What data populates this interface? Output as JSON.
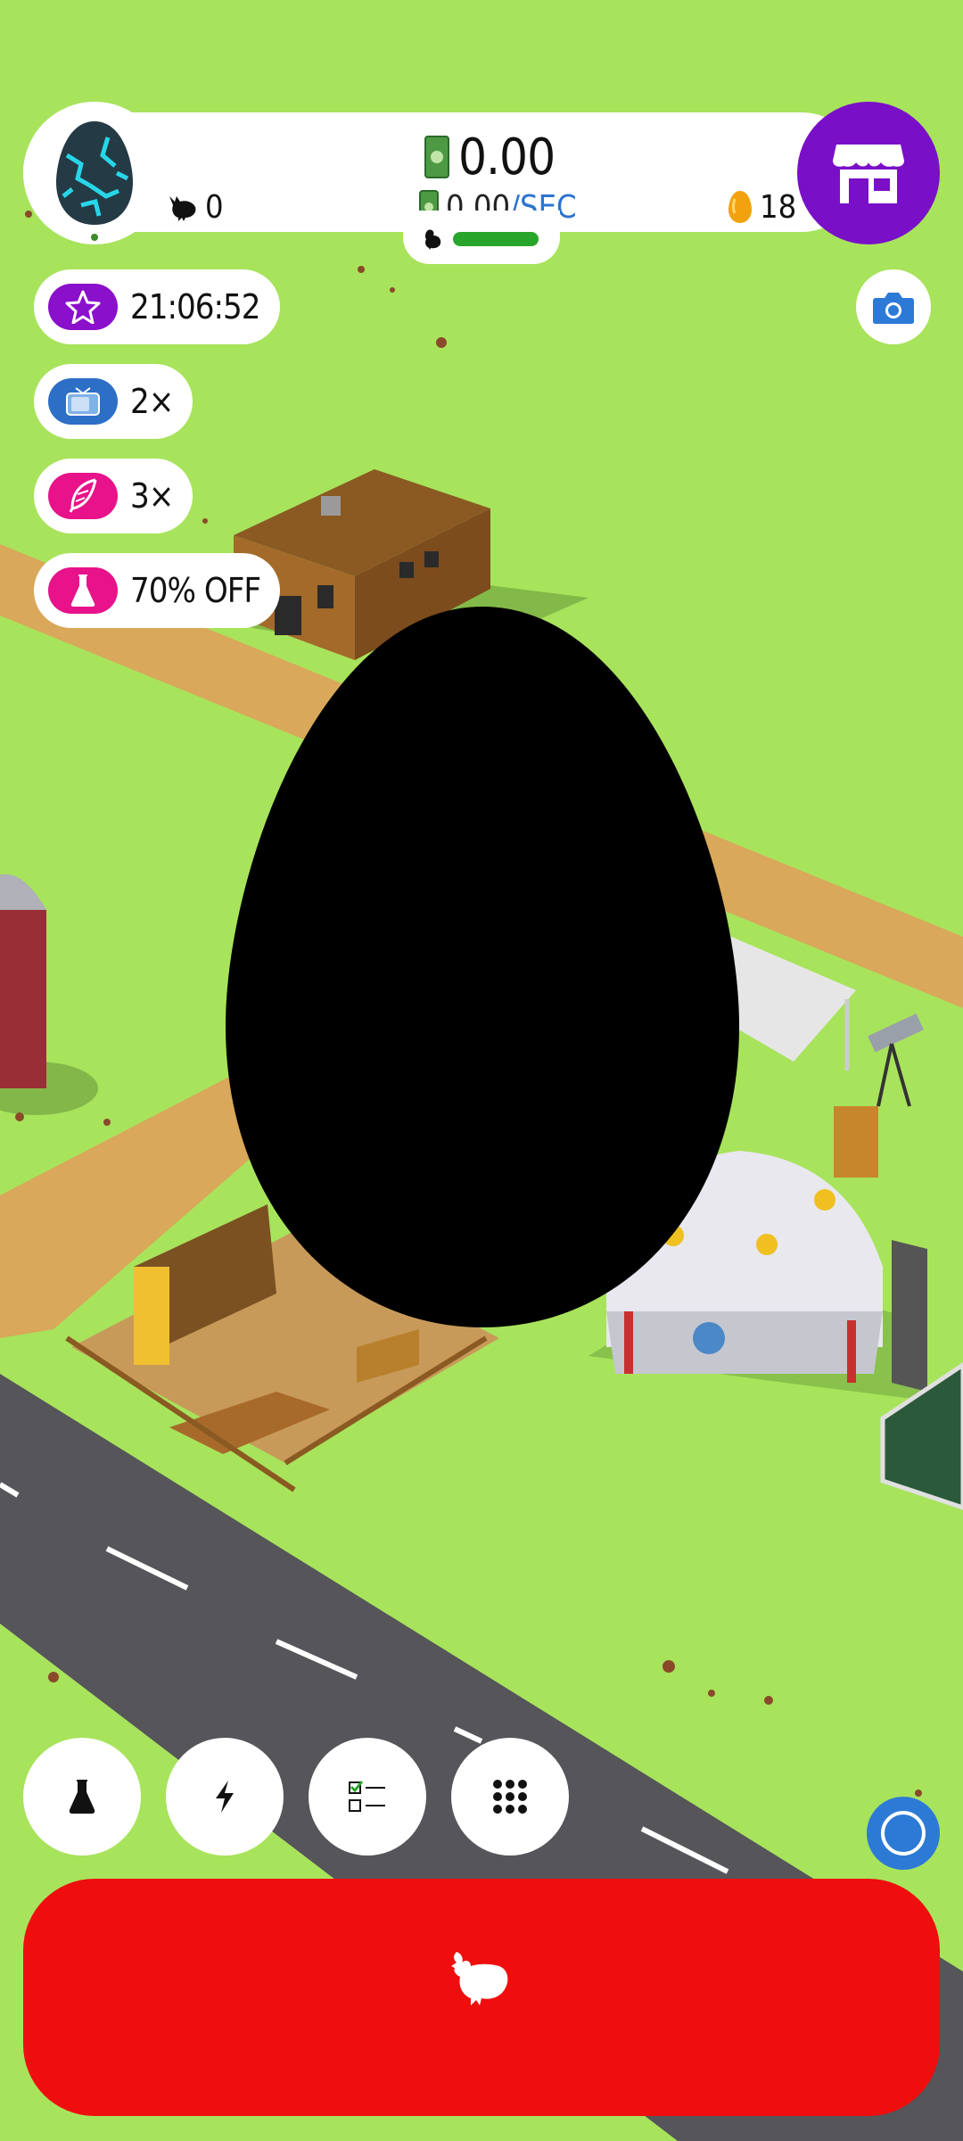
{
  "hud": {
    "money": "0.00",
    "rate_value": "0.00",
    "rate_separator": "/",
    "rate_unit": "SEC",
    "chicken_count": "0",
    "golden_eggs": "18"
  },
  "boosts": [
    {
      "icon": "star-icon",
      "text": "21:06:52",
      "color": "#8a10cc"
    },
    {
      "icon": "tv-icon",
      "text": "2×",
      "color": "#2d6fc7"
    },
    {
      "icon": "feather-icon",
      "text": "3×",
      "color": "#e8128a"
    },
    {
      "icon": "flask-icon",
      "text": "70% OFF",
      "color": "#e8128a"
    }
  ],
  "bottom_buttons": [
    "flask-icon",
    "lightning-icon",
    "checklist-icon",
    "grid-icon"
  ],
  "colors": {
    "grass": "#a8e35c",
    "shop": "#7a0fc8",
    "hatch": "#ee0e0e",
    "assist": "#2d7ad6"
  }
}
